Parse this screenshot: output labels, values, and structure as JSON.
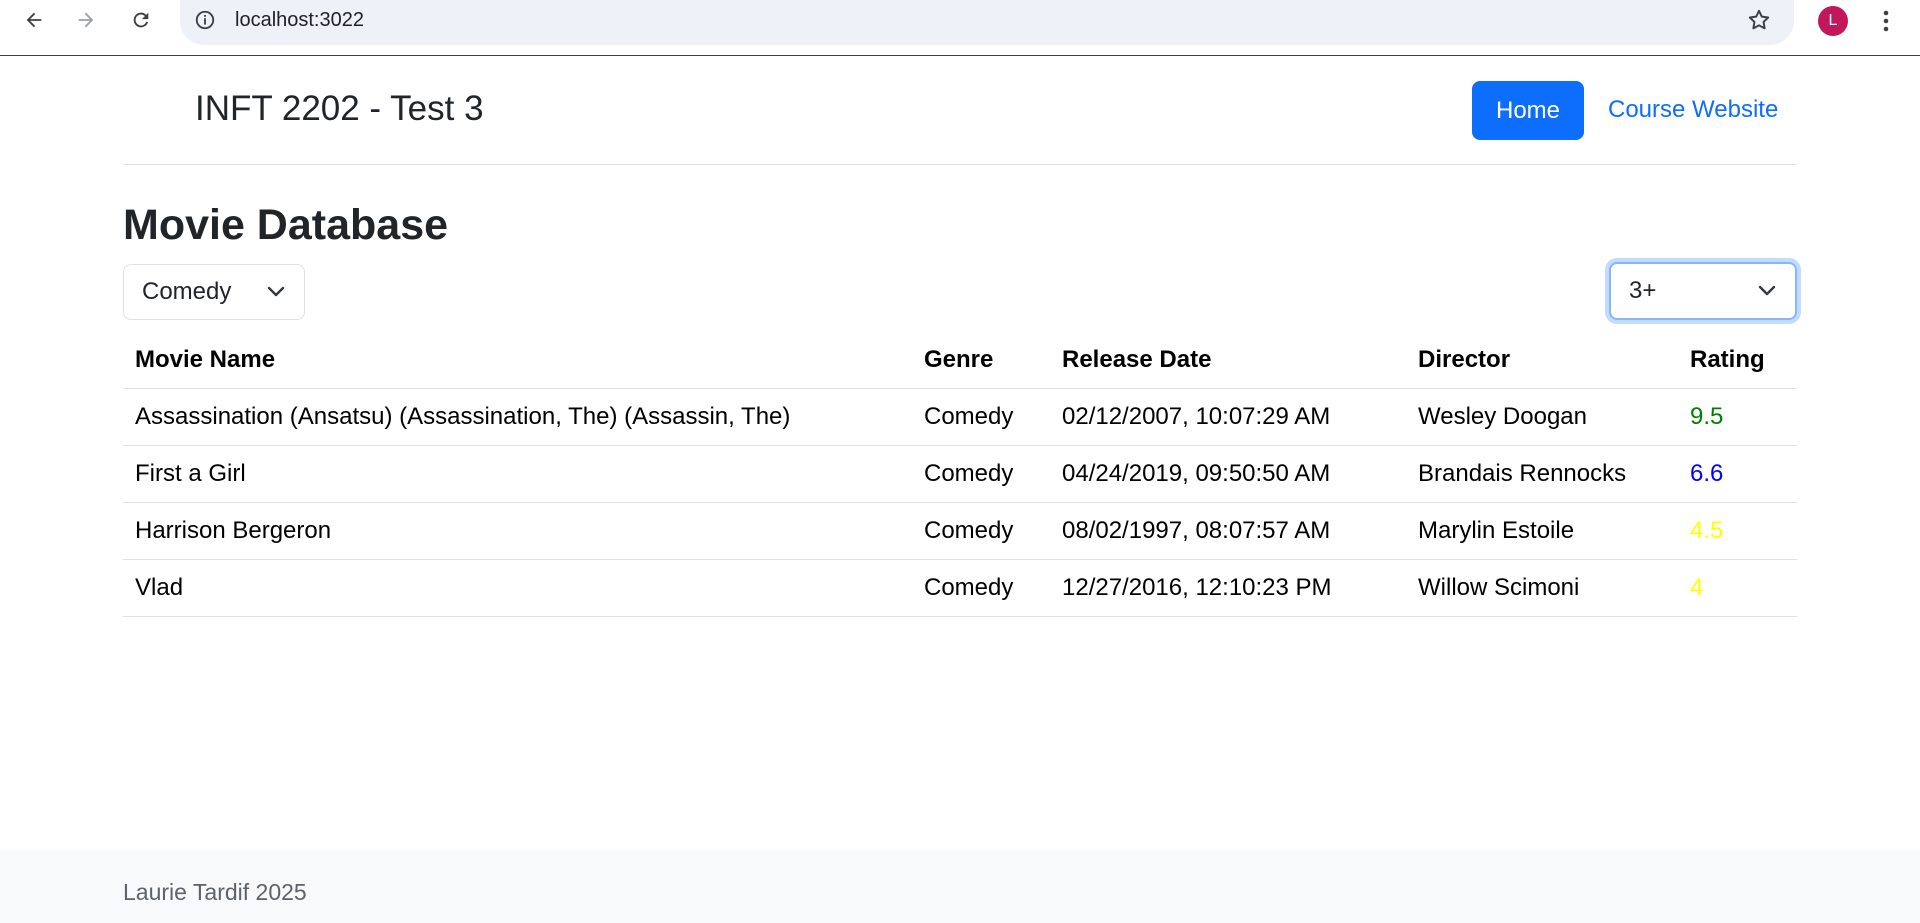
{
  "browser": {
    "url": "localhost:3022",
    "avatar_letter": "L"
  },
  "header": {
    "title": "INFT 2202 - Test 3",
    "home_label": "Home",
    "course_label": "Course Website"
  },
  "main": {
    "heading": "Movie Database",
    "genre_select": {
      "value": "Comedy"
    },
    "rating_select": {
      "value": "3+"
    },
    "columns": [
      "Movie Name",
      "Genre",
      "Release Date",
      "Director",
      "Rating"
    ],
    "rows": [
      {
        "name": "Assassination (Ansatsu) (Assassination, The) (Assassin, The)",
        "genre": "Comedy",
        "release": "02/12/2007, 10:07:29 AM",
        "director": "Wesley Doogan",
        "rating": "9.5",
        "rating_color": "#008000"
      },
      {
        "name": "First a Girl",
        "genre": "Comedy",
        "release": "04/24/2019, 09:50:50 AM",
        "director": "Brandais Rennocks",
        "rating": "6.6",
        "rating_color": "#0000ff"
      },
      {
        "name": "Harrison Bergeron",
        "genre": "Comedy",
        "release": "08/02/1997, 08:07:57 AM",
        "director": "Marylin Estoile",
        "rating": "4.5",
        "rating_color": "#ffff00"
      },
      {
        "name": "Vlad",
        "genre": "Comedy",
        "release": "12/27/2016, 12:10:23 PM",
        "director": "Willow Scimoni",
        "rating": "4",
        "rating_color": "#ffff00"
      }
    ]
  },
  "footer": {
    "text": "Laurie Tardif 2025"
  },
  "colors": {
    "primary": "#0d6efd",
    "avatar": "#c2185b"
  }
}
